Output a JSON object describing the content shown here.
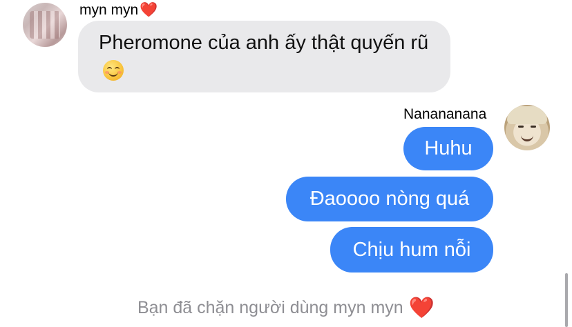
{
  "chat": {
    "incoming": {
      "sender": "myn myn",
      "sender_heart": "❤️",
      "message": "Pheromone của anh ấy thật quyến rũ",
      "emoji": "smiling-face-emoji",
      "avatar": "avatar-photo"
    },
    "outgoing": {
      "sender": "Nanananana",
      "avatar": "avatar-photo",
      "messages": [
        "Huhu",
        "Đaoooo nòng quá",
        "Chịu hum nỗi"
      ]
    },
    "blocked_notice": {
      "text": "Bạn đã chặn người dùng myn myn",
      "heart": "❤️"
    }
  },
  "colors": {
    "outgoing_bubble": "#3b86f7",
    "incoming_bubble": "#e9e9eb",
    "notice_text": "#8e8e93",
    "heart": "#e0262b"
  }
}
